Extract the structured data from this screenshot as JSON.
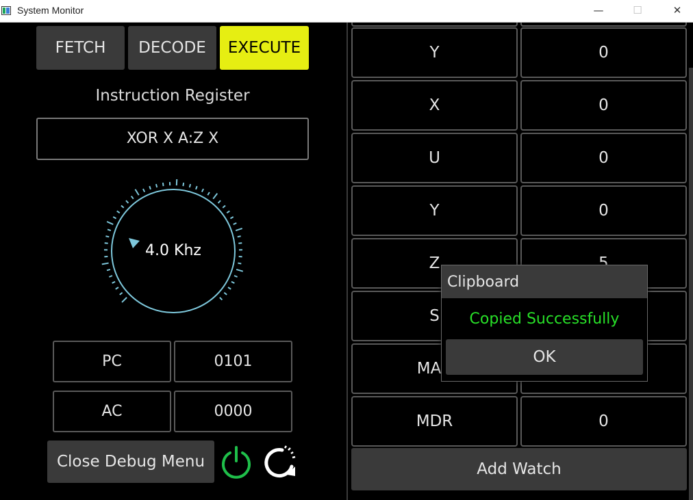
{
  "window": {
    "title": "System Monitor",
    "minimize": "—",
    "maximize": "☐",
    "close": "✕"
  },
  "stages": [
    {
      "label": "FETCH",
      "active": false
    },
    {
      "label": "DECODE",
      "active": false
    },
    {
      "label": "EXECUTE",
      "active": true
    }
  ],
  "instruction_register": {
    "label": "Instruction Register",
    "value": "XOR X A:Z X"
  },
  "clock": {
    "label": "4.0 Khz"
  },
  "registers": [
    {
      "name": "PC",
      "value": "0101"
    },
    {
      "name": "AC",
      "value": "0000"
    }
  ],
  "controls": {
    "close_debug": "Close Debug Menu",
    "power_icon": "power-icon",
    "reset_icon": "reset-icon"
  },
  "watch_list": [
    {
      "name": "Y",
      "value": "0"
    },
    {
      "name": "X",
      "value": "0"
    },
    {
      "name": "U",
      "value": "0"
    },
    {
      "name": "Y",
      "value": "0"
    },
    {
      "name": "Z",
      "value": "5"
    },
    {
      "name": "S",
      "value": ""
    },
    {
      "name": "MAR",
      "value": ""
    },
    {
      "name": "MDR",
      "value": "0"
    }
  ],
  "add_watch": "Add Watch",
  "dialog": {
    "title": "Clipboard",
    "message": "Copied Successfully",
    "ok": "OK"
  },
  "colors": {
    "accent": "#e6ee12",
    "dial": "#7ec8dc",
    "success": "#28e028"
  }
}
